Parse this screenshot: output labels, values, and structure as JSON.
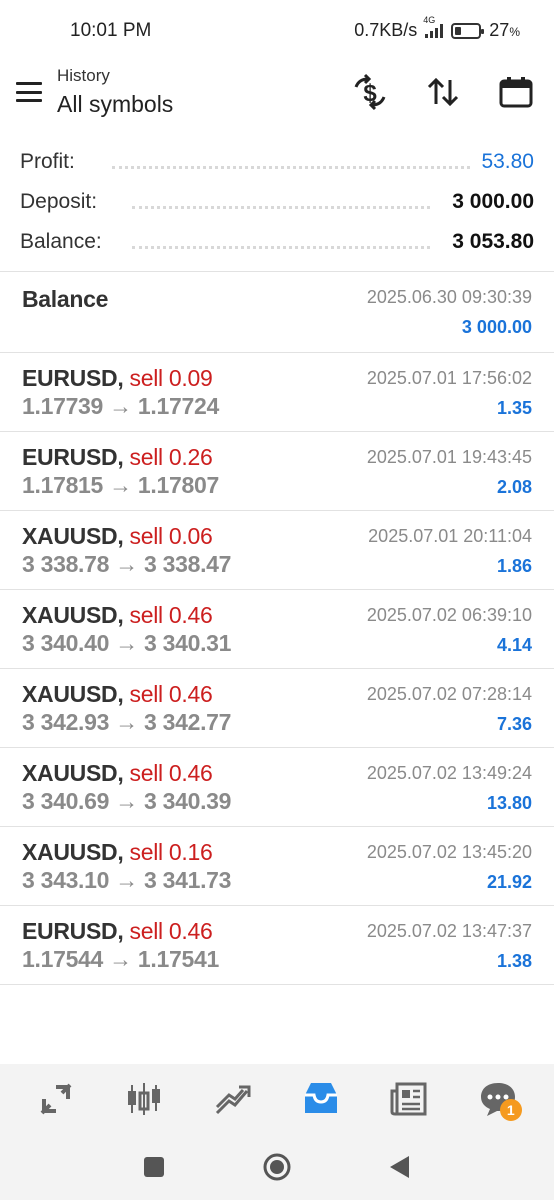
{
  "status_bar": {
    "time": "10:01 PM",
    "net_speed": "0.7KB/s",
    "network_type": "4G",
    "battery_percent_text": "27",
    "battery_unit": "%",
    "battery_level": 0.27
  },
  "header": {
    "subtitle": "History",
    "title": "All symbols",
    "icons": [
      "menu-icon",
      "currency-exchange-icon",
      "sort-icon",
      "calendar-icon"
    ]
  },
  "summary": {
    "profit_label": "Profit:",
    "profit_value": "53.80",
    "deposit_label": "Deposit:",
    "deposit_value": "3 000.00",
    "balance_label": "Balance:",
    "balance_value": "3 053.80"
  },
  "balance_entry": {
    "label": "Balance",
    "datetime": "2025.06.30 09:30:39",
    "amount": "3 000.00"
  },
  "deals": [
    {
      "symbol": "EURUSD,",
      "action": "sell 0.09",
      "prices": "1.17739 → 1.17724",
      "datetime": "2025.07.01 17:56:02",
      "profit": "1.35"
    },
    {
      "symbol": "EURUSD,",
      "action": "sell 0.26",
      "prices": "1.17815 → 1.17807",
      "datetime": "2025.07.01 19:43:45",
      "profit": "2.08"
    },
    {
      "symbol": "XAUUSD,",
      "action": "sell 0.06",
      "prices": "3 338.78 → 3 338.47",
      "datetime": "2025.07.01 20:11:04",
      "profit": "1.86"
    },
    {
      "symbol": "XAUUSD,",
      "action": "sell 0.46",
      "prices": "3 340.40 → 3 340.31",
      "datetime": "2025.07.02 06:39:10",
      "profit": "4.14"
    },
    {
      "symbol": "XAUUSD,",
      "action": "sell 0.46",
      "prices": "3 342.93 → 3 342.77",
      "datetime": "2025.07.02 07:28:14",
      "profit": "7.36"
    },
    {
      "symbol": "XAUUSD,",
      "action": "sell 0.46",
      "prices": "3 340.69 → 3 340.39",
      "datetime": "2025.07.02 13:49:24",
      "profit": "13.80"
    },
    {
      "symbol": "XAUUSD,",
      "action": "sell 0.16",
      "prices": "3 343.10 → 3 341.73",
      "datetime": "2025.07.02 13:45:20",
      "profit": "21.92"
    },
    {
      "symbol": "EURUSD,",
      "action": "sell 0.46",
      "prices": "1.17544 → 1.17541",
      "datetime": "2025.07.02 13:47:37",
      "profit": "1.38"
    }
  ],
  "bottom_nav": {
    "items": [
      "quotes-icon",
      "chart-icon",
      "trade-icon",
      "history-icon",
      "news-icon",
      "messages-icon"
    ],
    "active": "history-icon",
    "messages_badge": "1"
  },
  "colors": {
    "accent_blue": "#1a73d9",
    "sell_red": "#cc1f1f",
    "badge_orange": "#f59a1f"
  }
}
